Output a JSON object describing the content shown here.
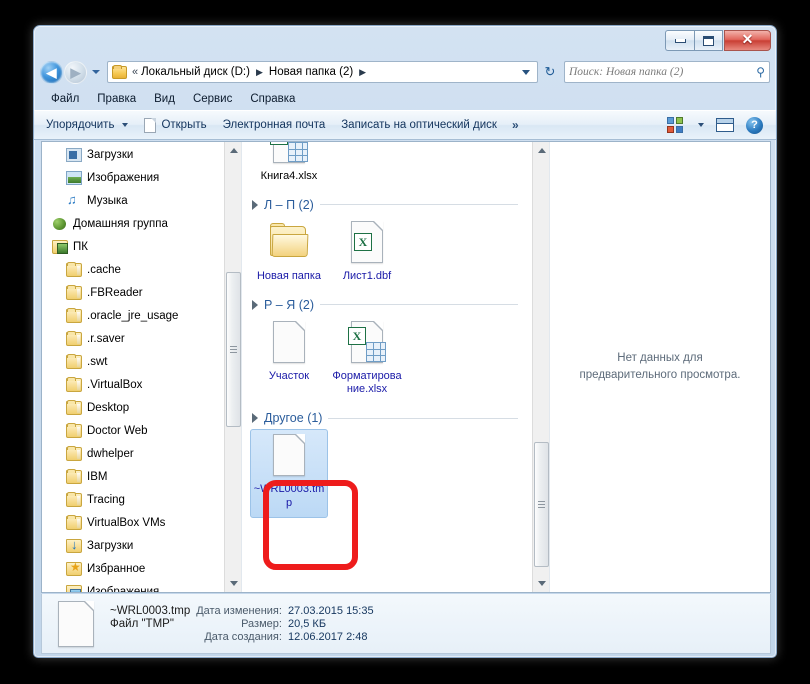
{
  "window": {
    "controls": {
      "minimize": "minimize-button",
      "maximize": "maximize-button",
      "close": "✕"
    }
  },
  "address_bar": {
    "back_glyph": "◀",
    "forward_glyph": "▶",
    "overflow_chevron": "«",
    "separator": "▶",
    "breadcrumbs": [
      "Локальный диск (D:)",
      "Новая папка (2)"
    ],
    "refresh_glyph": "↻"
  },
  "search": {
    "placeholder": "Поиск: Новая папка (2)",
    "value": "",
    "icon_glyph": "⚲"
  },
  "menu": {
    "items": [
      {
        "label": "Файл"
      },
      {
        "label": "Правка"
      },
      {
        "label": "Вид"
      },
      {
        "label": "Сервис"
      },
      {
        "label": "Справка"
      }
    ]
  },
  "toolbar": {
    "organize": "Упорядочить",
    "open": "Открыть",
    "email": "Электронная почта",
    "burn": "Записать на оптический диск",
    "overflow": "»",
    "help_glyph": "?"
  },
  "navigation_pane": {
    "items": [
      {
        "label": "Загрузки",
        "icon": "downloads-icon",
        "indent": 1
      },
      {
        "label": "Изображения",
        "icon": "pictures-icon",
        "indent": 1
      },
      {
        "label": "Музыка",
        "icon": "music-icon",
        "indent": 1
      },
      {
        "label": "Домашняя группа",
        "icon": "homegroup-icon",
        "indent": 0
      },
      {
        "label": "ПК",
        "icon": "pc-folder-icon",
        "indent": 0
      },
      {
        "label": ".cache",
        "icon": "folder-icon",
        "indent": 1
      },
      {
        "label": ".FBReader",
        "icon": "folder-icon",
        "indent": 1
      },
      {
        "label": ".oracle_jre_usage",
        "icon": "folder-icon",
        "indent": 1
      },
      {
        "label": ".r.saver",
        "icon": "folder-icon",
        "indent": 1
      },
      {
        "label": ".swt",
        "icon": "folder-icon",
        "indent": 1
      },
      {
        "label": ".VirtualBox",
        "icon": "folder-icon",
        "indent": 1
      },
      {
        "label": "Desktop",
        "icon": "folder-icon",
        "indent": 1
      },
      {
        "label": "Doctor Web",
        "icon": "folder-icon",
        "indent": 1
      },
      {
        "label": "dwhelper",
        "icon": "folder-icon",
        "indent": 1
      },
      {
        "label": "IBM",
        "icon": "folder-icon",
        "indent": 1
      },
      {
        "label": "Tracing",
        "icon": "folder-icon",
        "indent": 1
      },
      {
        "label": "VirtualBox VMs",
        "icon": "folder-icon",
        "indent": 1
      },
      {
        "label": "Загрузки",
        "icon": "downloads-folder-icon",
        "indent": 1
      },
      {
        "label": "Избранное",
        "icon": "favorites-folder-icon",
        "indent": 1
      },
      {
        "label": "Изображения",
        "icon": "pictures-folder-icon",
        "indent": 1
      }
    ]
  },
  "file_list": {
    "groups": [
      {
        "label": "",
        "items": [
          {
            "name": "Книга4.xlsx",
            "icon": "excel-file-icon",
            "selected": false
          }
        ]
      },
      {
        "label": "Л – П (2)",
        "items": [
          {
            "name": "Новая папка",
            "icon": "folder-icon",
            "selected": false
          },
          {
            "name": "Лист1.dbf",
            "icon": "excel-plain-icon",
            "selected": false
          }
        ]
      },
      {
        "label": "Р – Я (2)",
        "items": [
          {
            "name": "Участок",
            "icon": "blank-file-icon",
            "selected": false
          },
          {
            "name": "Форматирование.xlsx",
            "icon": "excel-file-icon",
            "selected": false
          }
        ]
      },
      {
        "label": "Другое (1)",
        "items": [
          {
            "name": "~WRL0003.tmp",
            "icon": "blank-file-icon",
            "selected": true
          }
        ]
      }
    ]
  },
  "preview_pane": {
    "message": "Нет данных для предварительного просмотра."
  },
  "status_bar": {
    "file_name": "~WRL0003.tmp",
    "file_type": "Файл \"TMP\"",
    "modified_key": "Дата изменения:",
    "modified_value": "27.03.2015 15:35",
    "size_key": "Размер:",
    "size_value": "20,5 КБ",
    "created_key": "Дата создания:",
    "created_value": "12.06.2017 2:48"
  },
  "annotation": {
    "color": "#ee1c1c",
    "target": "~WRL0003.tmp"
  }
}
